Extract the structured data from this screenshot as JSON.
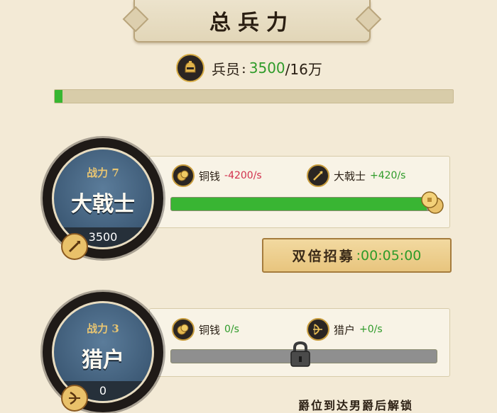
{
  "header": {
    "title": "总兵力"
  },
  "troops": {
    "label": "兵员",
    "separator": ":",
    "current": "3500",
    "max": "/16万",
    "progress_fraction": 0.02
  },
  "units": [
    {
      "power": "战力 7",
      "name": "大戟士",
      "count": "3500",
      "cost_label": "铜钱",
      "cost_rate": "-4200/s",
      "gain_label": "大戟士",
      "gain_rate": "+420/s",
      "progress_fraction": 0.98,
      "double_recruit": {
        "label": "双倍招募",
        "separator": ":",
        "timer": "00:05:00"
      }
    },
    {
      "power": "战力 3",
      "name": "猎户",
      "count": "0",
      "cost_label": "铜钱",
      "cost_rate": "0/s",
      "gain_label": "猎户",
      "gain_rate": "+0/s",
      "progress_fraction": 0.0,
      "locked": true,
      "unlock_note": "爵位到达男爵后解锁"
    }
  ],
  "colors": {
    "accent_green": "#39b533",
    "rate_red": "#d2314e",
    "panel_bg": "#f8f3e6"
  },
  "icons": [
    "helmet-icon",
    "coin-icon",
    "halberd-icon",
    "bow-icon",
    "lock-icon"
  ]
}
